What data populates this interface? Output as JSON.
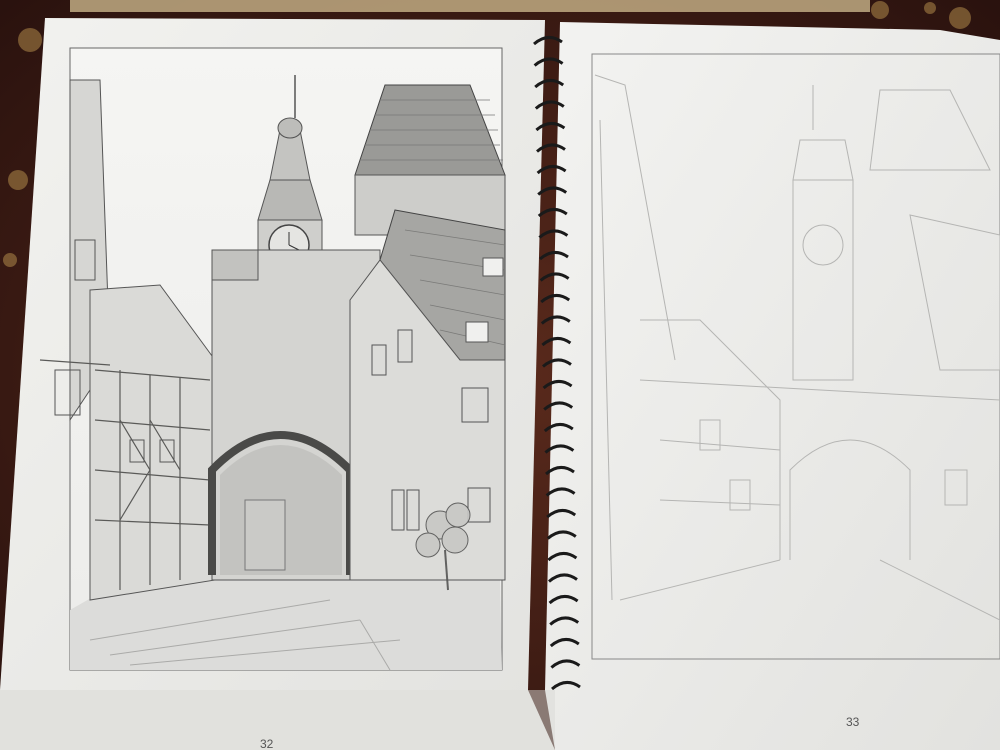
{
  "sketchbook": {
    "left_page": {
      "page_number": "32",
      "content": "pencil-drawing"
    },
    "right_page": {
      "page_number": "33",
      "content": "faint-outline"
    }
  },
  "colors": {
    "tablecloth": "#3a1a14",
    "paper": "#eeeeeb",
    "pencil": "#555555",
    "spiral": "#1a1a1a"
  }
}
